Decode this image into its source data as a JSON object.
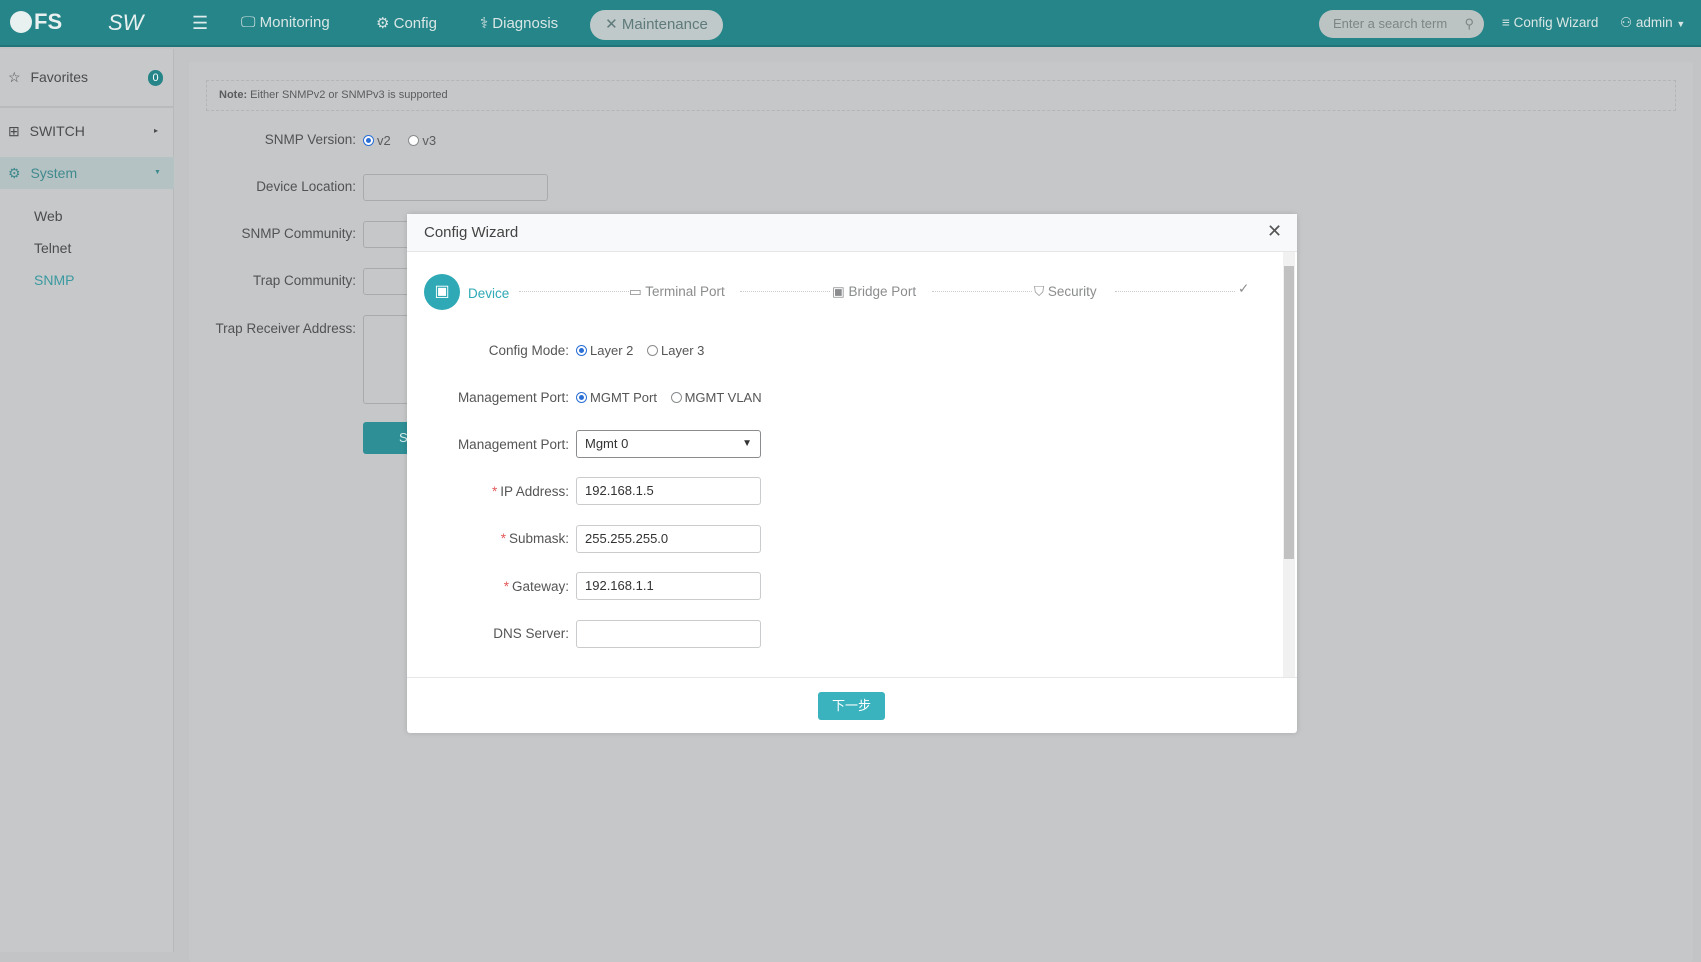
{
  "topbar": {
    "logo": "FS",
    "product": "SW",
    "nav": [
      {
        "label": "Monitoring",
        "icon": "monitor-icon"
      },
      {
        "label": "Config",
        "icon": "gear-icon"
      },
      {
        "label": "Diagnosis",
        "icon": "stethoscope-icon"
      },
      {
        "label": "Maintenance",
        "icon": "tools-icon",
        "active": true
      }
    ],
    "search_placeholder": "Enter a search term",
    "config_wizard": "Config Wizard",
    "user": "admin"
  },
  "sidebar": {
    "favorites": "Favorites",
    "favorites_count": "0",
    "items": [
      {
        "label": "SWITCH"
      },
      {
        "label": "System",
        "expanded": true
      }
    ],
    "sub_items": [
      {
        "label": "Web"
      },
      {
        "label": "Telnet"
      },
      {
        "label": "SNMP",
        "active": true
      }
    ]
  },
  "page": {
    "note_label": "Note:",
    "note_text": "Either SNMPv2 or SNMPv3 is supported",
    "snmp_version_label": "SNMP Version:",
    "v2": "v2",
    "v3": "v3",
    "device_location_label": "Device Location:",
    "snmp_community_label": "SNMP Community:",
    "trap_community_label": "Trap Community:",
    "trap_receiver_label": "Trap Receiver Address:",
    "save_partial": "S"
  },
  "modal": {
    "title": "Config Wizard",
    "steps": [
      {
        "label": "Device",
        "active": true
      },
      {
        "label": "Terminal Port"
      },
      {
        "label": "Bridge Port"
      },
      {
        "label": "Security"
      }
    ],
    "config_mode_label": "Config Mode:",
    "layer2": "Layer 2",
    "layer3": "Layer 3",
    "mgmt_port_label": "Management Port:",
    "mgmt_port_opt": "MGMT Port",
    "mgmt_vlan_opt": "MGMT VLAN",
    "mgmt_port_select_label": "Management Port:",
    "mgmt_port_value": "Mgmt 0",
    "ip_label": "IP Address:",
    "ip_value": "192.168.1.5",
    "submask_label": "Submask:",
    "submask_value": "255.255.255.0",
    "gateway_label": "Gateway:",
    "gateway_value": "192.168.1.1",
    "dns_label": "DNS Server:",
    "dns_value": "",
    "next_button": "下一步"
  },
  "colors": {
    "brand": "#268588",
    "accent": "#3ab3bf",
    "radio": "#2a6fd6"
  }
}
